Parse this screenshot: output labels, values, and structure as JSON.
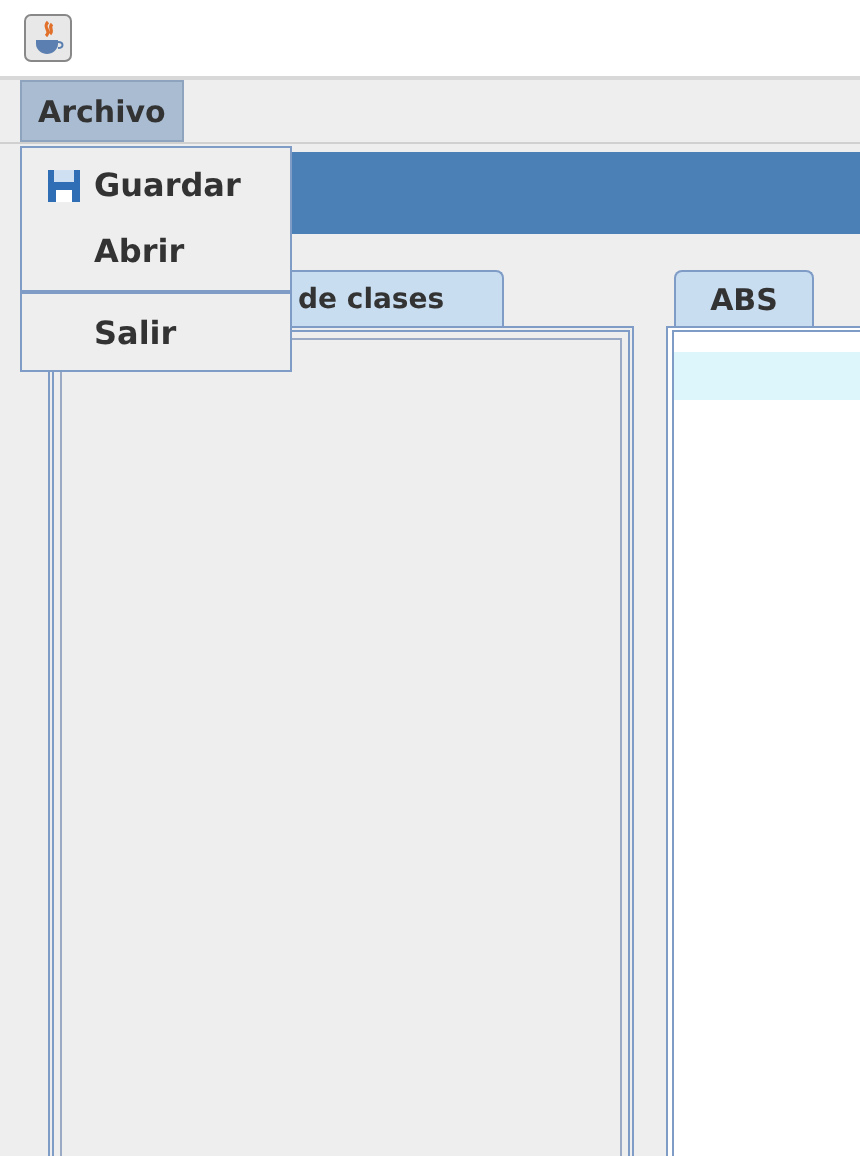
{
  "menu_bar": [
    {
      "label": "Archivo",
      "selected": true
    }
  ],
  "open_menu": {
    "items": [
      {
        "kind": "icon_item",
        "label": "Guardar"
      },
      {
        "kind": "item",
        "label": "Abrir"
      },
      {
        "kind": "separator"
      },
      {
        "kind": "item",
        "label": "Salir"
      }
    ]
  },
  "left_pane": {
    "tabs": [
      {
        "label": "de clases",
        "selected": true
      }
    ]
  },
  "right_pane": {
    "tabs": [
      {
        "label": "ABS",
        "selected": true
      }
    ]
  }
}
